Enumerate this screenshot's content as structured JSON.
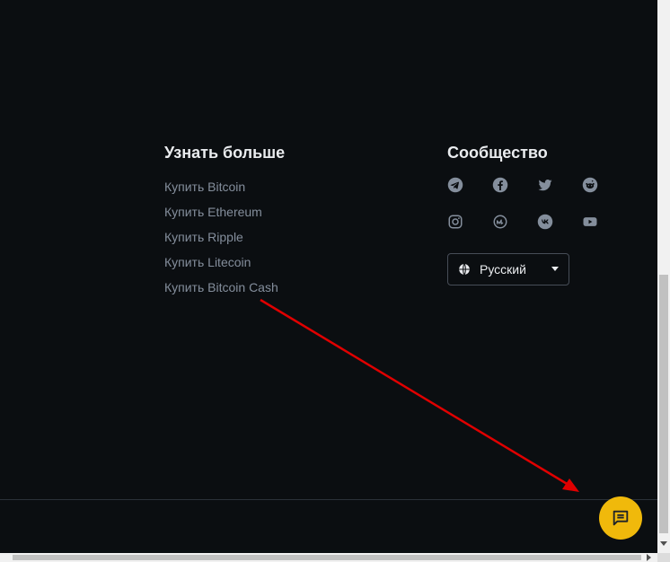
{
  "footer": {
    "learn_more": {
      "title": "Узнать больше",
      "links": [
        "Купить Bitcoin",
        "Купить Ethereum",
        "Купить Ripple",
        "Купить Litecoin",
        "Купить Bitcoin Cash"
      ]
    },
    "community": {
      "title": "Сообщество",
      "social_icons": [
        "telegram-icon",
        "facebook-icon",
        "twitter-icon",
        "reddit-icon",
        "instagram-icon",
        "coinmarketcap-icon",
        "vk-icon",
        "youtube-icon"
      ]
    },
    "language": {
      "icon": "globe-icon",
      "selected": "Русский"
    }
  },
  "chat": {
    "icon": "chat-icon"
  },
  "colors": {
    "background": "#0b0e11",
    "heading": "#eaecef",
    "link": "#848e9c",
    "icon": "#848e9c",
    "accent": "#f0b90b",
    "annotation_arrow": "#e00000"
  }
}
